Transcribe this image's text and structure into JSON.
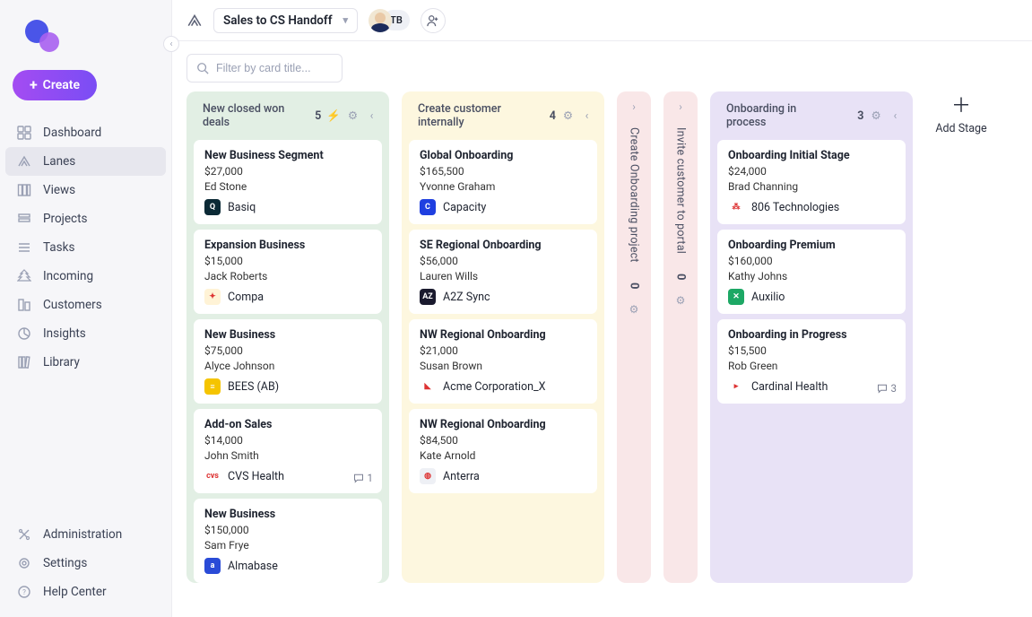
{
  "create_label": "Create",
  "sidebar": {
    "items": [
      {
        "label": "Dashboard"
      },
      {
        "label": "Lanes"
      },
      {
        "label": "Views"
      },
      {
        "label": "Projects"
      },
      {
        "label": "Tasks"
      },
      {
        "label": "Incoming"
      },
      {
        "label": "Customers"
      },
      {
        "label": "Insights"
      },
      {
        "label": "Library"
      }
    ],
    "bottom": [
      {
        "label": "Administration"
      },
      {
        "label": "Settings"
      },
      {
        "label": "Help Center"
      }
    ]
  },
  "topbar": {
    "lane_name": "Sales to CS Handoff",
    "user_initials": "TB"
  },
  "filter": {
    "placeholder": "Filter by card title..."
  },
  "board": {
    "add_stage_label": "Add Stage",
    "columns": [
      {
        "title": "New closed won deals",
        "count": "5",
        "cards": [
          {
            "title": "New Business Segment",
            "amount": "$27,000",
            "owner": "Ed Stone",
            "company": "Basiq",
            "logo_bg": "#0b2a36",
            "logo_txt": "Q"
          },
          {
            "title": "Expansion Business",
            "amount": "$15,000",
            "owner": "Jack Roberts",
            "company": "Compa",
            "logo_bg": "#fff3d6",
            "logo_txt": "✦"
          },
          {
            "title": "New Business",
            "amount": "$75,000",
            "owner": "Alyce Johnson",
            "company": "BEES (AB)",
            "logo_bg": "#f5c400",
            "logo_txt": "≡"
          },
          {
            "title": "Add-on Sales",
            "amount": "$14,000",
            "owner": "John Smith",
            "company": "CVS Health",
            "logo_bg": "#fff",
            "logo_txt": "cvs",
            "comments": "1"
          },
          {
            "title": "New Business",
            "amount": "$150,000",
            "owner": "Sam Frye",
            "company": "Almabase",
            "logo_bg": "#2a4bd7",
            "logo_txt": "a"
          }
        ]
      },
      {
        "title": "Create customer internally",
        "count": "4",
        "cards": [
          {
            "title": "Global Onboarding",
            "amount": "$165,500",
            "owner": "Yvonne Graham",
            "company": "Capacity",
            "logo_bg": "#1f3fe0",
            "logo_txt": "C"
          },
          {
            "title": "SE Regional Onboarding",
            "amount": "$56,000",
            "owner": "Lauren Wills",
            "company": "A2Z Sync",
            "logo_bg": "#1a1a2e",
            "logo_txt": "AZ"
          },
          {
            "title": "NW Regional Onboarding",
            "amount": "$21,000",
            "owner": "Susan Brown",
            "company": "Acme Corporation_X",
            "logo_bg": "#fff",
            "logo_txt": "◣"
          },
          {
            "title": "NW Regional Onboarding",
            "amount": "$84,500",
            "owner": "Kate Arnold",
            "company": "Anterra",
            "logo_bg": "#eef0f5",
            "logo_txt": "◍"
          }
        ]
      },
      {
        "title": "Onboarding in process",
        "count": "3",
        "cards": [
          {
            "title": "Onboarding Initial Stage",
            "amount": "$24,000",
            "owner": "Brad Channing",
            "company": "806 Technologies",
            "logo_bg": "#fff",
            "logo_txt": "⁂"
          },
          {
            "title": "Onboarding Premium",
            "amount": "$160,000",
            "owner": "Kathy Johns",
            "company": "Auxilio",
            "logo_bg": "#1da865",
            "logo_txt": "✕"
          },
          {
            "title": "Onboarding in Progress",
            "amount": "$15,500",
            "owner": "Rob Green",
            "company": "Cardinal Health",
            "logo_bg": "#fff",
            "logo_txt": "▸",
            "comments": "3"
          }
        ]
      }
    ],
    "collapsed": [
      {
        "title": "Create Onboarding project",
        "count": "0"
      },
      {
        "title": "Invite customer to portal",
        "count": "0"
      }
    ]
  }
}
